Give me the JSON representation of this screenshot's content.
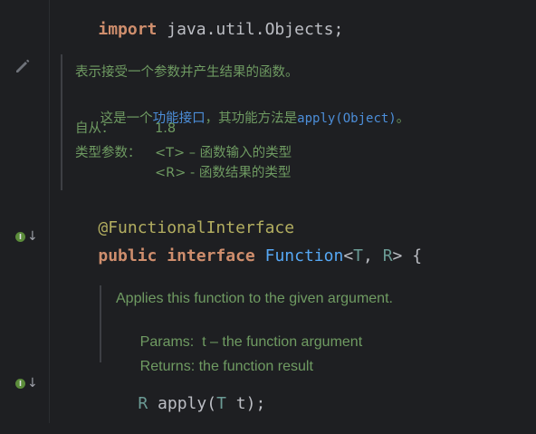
{
  "code": {
    "import_kw": "import",
    "import_path": " java.util.Objects;",
    "annotation": "@FunctionalInterface",
    "public_kw": "public",
    "interface_kw": "interface",
    "interface_name": "Function",
    "type_open": "<",
    "type_t": "T",
    "type_comma": ", ",
    "type_r": "R",
    "type_close": ">",
    "brace_open": " {",
    "method_return": "R",
    "method_name": "apply",
    "method_paren_open": "(",
    "method_param_type": "T",
    "method_param_name": " t",
    "method_end": ");"
  },
  "doc_cn": {
    "summary": "表示接受一个参数并产生结果的函数。",
    "line2_prefix": "这是一个",
    "line2_link": "功能接口",
    "line2_mid": "，其功能方法是",
    "line2_code": "apply(Object)",
    "line2_end": "。",
    "since_label": "自从：",
    "since_value": "1.8",
    "tparams_label": "类型参数：",
    "tparam_t": "<T> – 函数输入的类型",
    "tparam_r": "<R> - 函数结果的类型"
  },
  "doc_en": {
    "summary": "Applies this function to the given argument.",
    "params_label": "Params:",
    "params_value": "t – the function argument",
    "returns_label": "Returns:",
    "returns_value": "the function result"
  },
  "gutter": {
    "edit_icon": "pencil-icon",
    "impl_badge": "I",
    "arrow": "↓"
  },
  "colors": {
    "background": "#1e1f22",
    "keyword": "#cf8e6d",
    "annotation": "#b3ae60",
    "interface_name": "#56a8f5",
    "type_param": "#16baac",
    "doc_text": "#6f9b62",
    "doc_link": "#4c8ed9"
  }
}
